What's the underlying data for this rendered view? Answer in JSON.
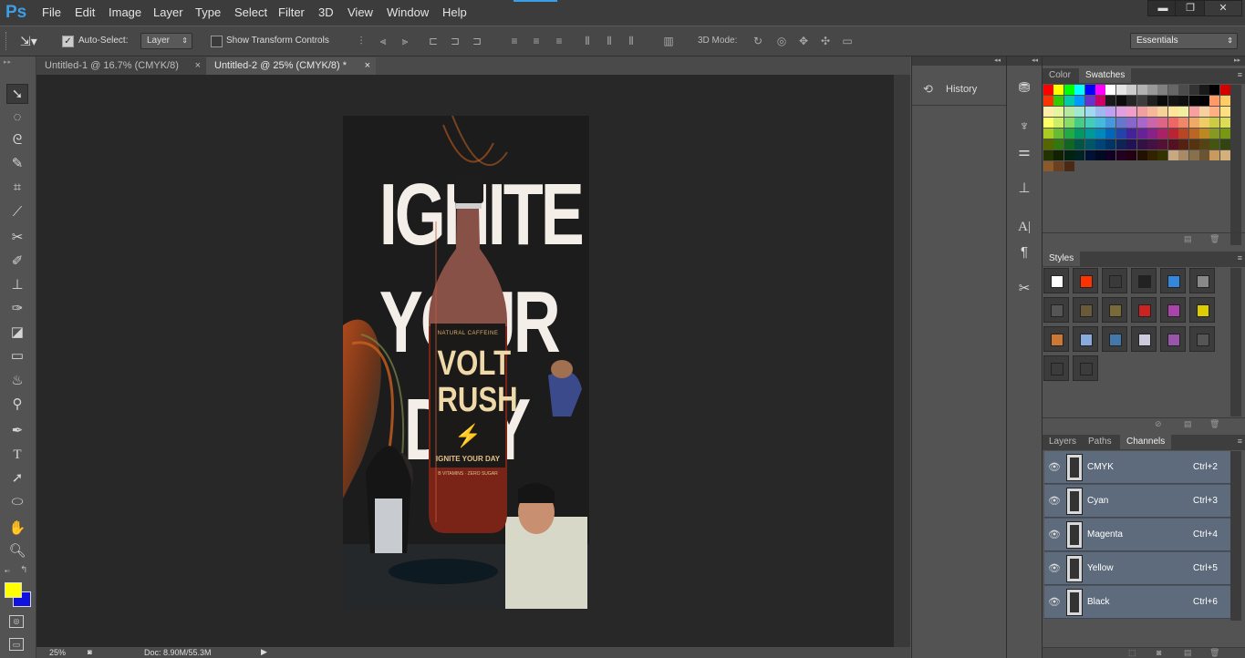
{
  "app": {
    "logo": "Ps"
  },
  "menu": [
    "File",
    "Edit",
    "Image",
    "Layer",
    "Type",
    "Select",
    "Filter",
    "3D",
    "View",
    "Window",
    "Help"
  ],
  "window_controls": {
    "minimize": "▬",
    "restore": "❐",
    "close": "✕"
  },
  "options": {
    "auto_select_label": "Auto-Select:",
    "auto_select_value": "Layer",
    "transform_label": "Show Transform Controls",
    "mode_label": "3D Mode:",
    "workspace": "Essentials"
  },
  "tabs": [
    {
      "label": "Untitled-1 @ 16.7% (CMYK/8)",
      "close": "×"
    },
    {
      "label": "Untitled-2 @ 25% (CMYK/8) *",
      "close": "×"
    }
  ],
  "tools": [
    "move-tool",
    "marquee-tool",
    "lasso-tool",
    "quick-select-tool",
    "crop-tool",
    "eyedropper-tool",
    "healing-tool",
    "brush-tool",
    "stamp-tool",
    "history-brush-tool",
    "eraser-tool",
    "gradient-tool",
    "blur-tool",
    "dodge-tool",
    "pen-tool",
    "type-tool",
    "path-select-tool",
    "shape-tool",
    "hand-tool",
    "zoom-tool"
  ],
  "colors": {
    "foreground": "#ffff00",
    "background": "#1010e0"
  },
  "artwork": {
    "headline_lines": [
      "IGNITE",
      "YOUR",
      "DAY"
    ],
    "bottle": {
      "top_text": "NATURAL CAFFEINE",
      "brand_line1": "VOLT",
      "brand_line2": "RUSH",
      "bolt": "⚡",
      "tagline": "IGNITE YOUR DAY",
      "footer": "B VITAMINS · ZERO SUGAR"
    }
  },
  "status": {
    "zoom": "25%",
    "doc": "Doc: 8.90M/55.3M"
  },
  "history_panel": {
    "label": "History"
  },
  "color_panel": {
    "tabs": [
      "Color",
      "Swatches"
    ],
    "active": "Swatches"
  },
  "styles_panel": {
    "label": "Styles"
  },
  "layers_panel": {
    "tabs": [
      "Layers",
      "Paths",
      "Channels"
    ],
    "active": "Channels",
    "channels": [
      {
        "name": "CMYK",
        "shortcut": "Ctrl+2"
      },
      {
        "name": "Cyan",
        "shortcut": "Ctrl+3"
      },
      {
        "name": "Magenta",
        "shortcut": "Ctrl+4"
      },
      {
        "name": "Yellow",
        "shortcut": "Ctrl+5"
      },
      {
        "name": "Black",
        "shortcut": "Ctrl+6"
      }
    ]
  },
  "swatches": [
    [
      "#ff0000",
      "#ffff00",
      "#00ff00",
      "#00ffff",
      "#0000ff",
      "#ff00ff",
      "#ffffff",
      "#e5e5e5",
      "#cccccc",
      "#b2b2b2",
      "#999999",
      "#808080",
      "#666666",
      "#4c4c4c",
      "#333333",
      "#191919",
      "#000000",
      "#d40000"
    ],
    [
      "#ff3300",
      "#33cc00",
      "#00ccaa",
      "#0099ff",
      "#6633cc",
      "#cc0066",
      "#1a1a1a",
      "#0d0d0d",
      "#262626",
      "#3d3d3d",
      "#202020",
      "#0a0a0a",
      "#151515",
      "#101010",
      "#050505",
      "#000000",
      "#ff9966",
      "#ffcc66"
    ],
    [
      "#ffeeaa",
      "#e8f5a0",
      "#b5e8a0",
      "#a0e8d0",
      "#a0d8f0",
      "#a0b8f0",
      "#c0a0f0",
      "#e0a0e0",
      "#f0a0c8",
      "#f0a0a0",
      "#f5b89a",
      "#f5d29a",
      "#ffe59a",
      "#f0f0a0",
      "#f7a0a0",
      "#f5d0a0",
      "#ffb080",
      "#ffe080"
    ],
    [
      "#ffff66",
      "#ccee66",
      "#88dd66",
      "#44cc88",
      "#44ccbb",
      "#44bbdd",
      "#4499dd",
      "#6677cc",
      "#8866cc",
      "#aa66cc",
      "#cc66aa",
      "#dd6688",
      "#ee6666",
      "#ee8866",
      "#eeaa66",
      "#eecc66",
      "#cccc44",
      "#dddd55"
    ],
    [
      "#aacc22",
      "#66bb33",
      "#22aa44",
      "#009966",
      "#009999",
      "#0088bb",
      "#0066bb",
      "#2244aa",
      "#442299",
      "#662299",
      "#882288",
      "#aa2266",
      "#bb2233",
      "#bb4422",
      "#bb6622",
      "#bb8822",
      "#889922",
      "#779911"
    ],
    [
      "#556600",
      "#337711",
      "#116622",
      "#005544",
      "#005566",
      "#004477",
      "#003366",
      "#112255",
      "#221155",
      "#331144",
      "#441144",
      "#551133",
      "#551122",
      "#552211",
      "#553311",
      "#554411",
      "#445511",
      "#334411"
    ],
    [
      "#223300",
      "#112200",
      "#002211",
      "#002222",
      "#001133",
      "#000a22",
      "#110022",
      "#220022",
      "#220011",
      "#221100",
      "#332200",
      "#333300",
      "#c8a880",
      "#a88a66",
      "#88704c",
      "#6a5434",
      "#c99a5c",
      "#d4b07a"
    ],
    [
      "#8a5a2a",
      "#6a4020",
      "#4a2a14"
    ]
  ],
  "styles": [
    [
      "#ffffff",
      "#ff3300",
      "#3a3a3a",
      "#222222",
      "#3388dd",
      "#888888"
    ],
    [
      "#555555",
      "#6a5a3a",
      "#7a6a3a",
      "#cc2222",
      "#aa44aa",
      "#ddcc00"
    ],
    [
      "#cc7733",
      "#88aadd",
      "#4477aa",
      "#ccccdd",
      "#9955aa",
      "#555555"
    ],
    [
      "#3c3c3c",
      "#3c3c3c"
    ]
  ]
}
